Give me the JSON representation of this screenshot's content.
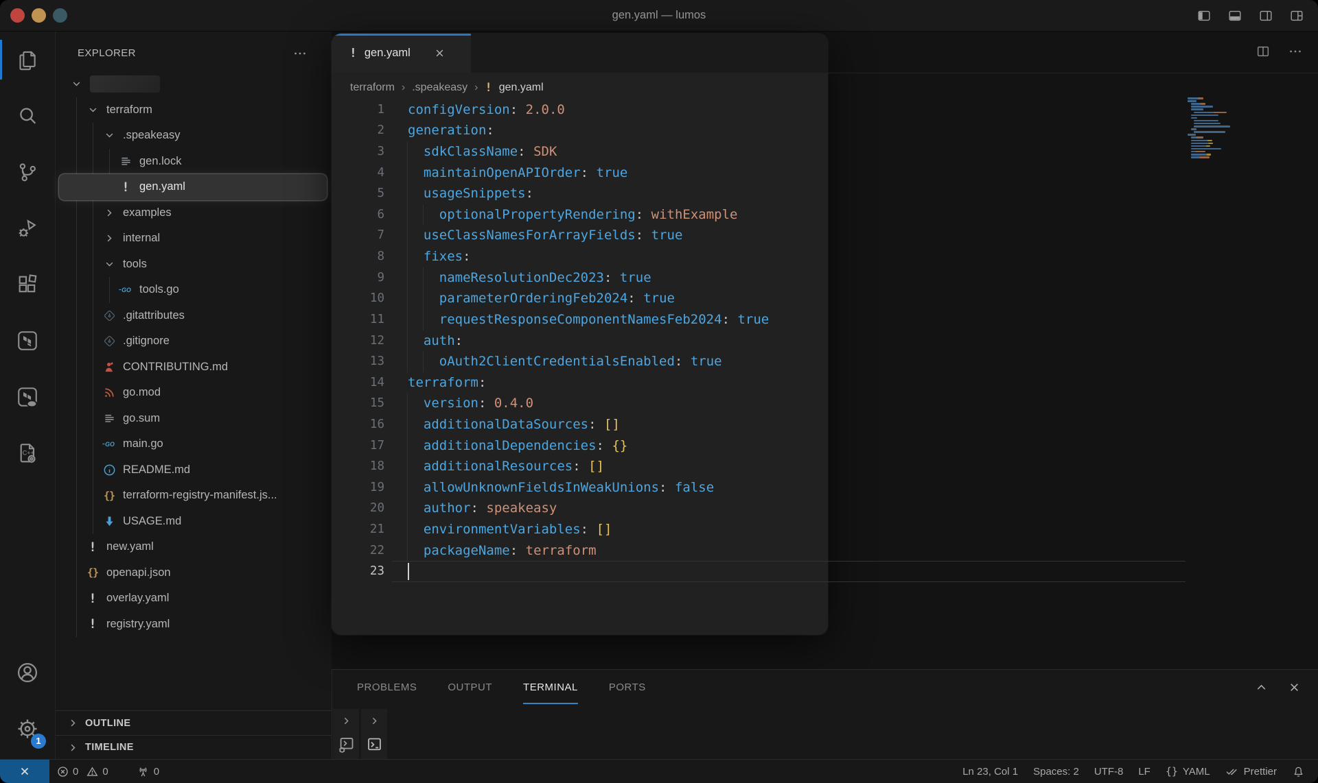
{
  "window": {
    "title": "gen.yaml — lumos",
    "traffic_lights": [
      {
        "name": "close",
        "color": "#c0453e"
      },
      {
        "name": "minimize",
        "color": "#bf9351"
      },
      {
        "name": "zoom",
        "color": "#3b5866"
      }
    ],
    "titlebar_actions": [
      "toggle-primary-sidebar",
      "toggle-panel",
      "toggle-secondary-sidebar",
      "customize-layout"
    ]
  },
  "activity_bar": {
    "top": [
      {
        "name": "explorer",
        "active": true
      },
      {
        "name": "search"
      },
      {
        "name": "source-control"
      },
      {
        "name": "run-and-debug"
      },
      {
        "name": "extensions"
      },
      {
        "name": "terraform"
      },
      {
        "name": "terraform-cloud"
      },
      {
        "name": "api-docs"
      }
    ],
    "bottom": [
      {
        "name": "accounts"
      },
      {
        "name": "manage",
        "badge": "1"
      }
    ]
  },
  "explorer": {
    "title": "EXPLORER",
    "tree": [
      {
        "type": "root",
        "label": "",
        "indent": 0,
        "chevron": "expanded",
        "redacted": true
      },
      {
        "label": "terraform",
        "indent": 1,
        "chevron": "expanded"
      },
      {
        "label": ".speakeasy",
        "indent": 2,
        "chevron": "expanded"
      },
      {
        "label": "gen.lock",
        "indent": 3,
        "icon": "list"
      },
      {
        "label": "gen.yaml",
        "indent": 3,
        "icon": "yaml-warn",
        "selected": true
      },
      {
        "label": "examples",
        "indent": 2,
        "chevron": "collapsed"
      },
      {
        "label": "internal",
        "indent": 2,
        "chevron": "collapsed"
      },
      {
        "label": "tools",
        "indent": 2,
        "chevron": "expanded"
      },
      {
        "label": "tools.go",
        "indent": 3,
        "icon": "go"
      },
      {
        "label": ".gitattributes",
        "indent": 2,
        "icon": "git"
      },
      {
        "label": ".gitignore",
        "indent": 2,
        "icon": "git"
      },
      {
        "label": "CONTRIBUTING.md",
        "indent": 2,
        "icon": "contrib"
      },
      {
        "label": "go.mod",
        "indent": 2,
        "icon": "gomod"
      },
      {
        "label": "go.sum",
        "indent": 2,
        "icon": "list"
      },
      {
        "label": "main.go",
        "indent": 2,
        "icon": "go"
      },
      {
        "label": "README.md",
        "indent": 2,
        "icon": "info"
      },
      {
        "label": "terraform-registry-manifest.js...",
        "indent": 2,
        "icon": "json"
      },
      {
        "label": "USAGE.md",
        "indent": 2,
        "icon": "arrow-down"
      },
      {
        "label": "new.yaml",
        "indent": 1,
        "icon": "yaml-warn"
      },
      {
        "label": "openapi.json",
        "indent": 1,
        "icon": "json"
      },
      {
        "label": "overlay.yaml",
        "indent": 1,
        "icon": "yaml-warn"
      },
      {
        "label": "registry.yaml",
        "indent": 1,
        "icon": "yaml-warn"
      }
    ],
    "sections": [
      "OUTLINE",
      "TIMELINE"
    ]
  },
  "editor": {
    "tab": {
      "label": "gen.yaml"
    },
    "breadcrumb": [
      "terraform",
      ".speakeasy",
      "gen.yaml"
    ],
    "cursor": {
      "line": 23,
      "col": 1
    },
    "code": [
      {
        "i": 0,
        "t": [
          [
            "configVersion",
            "k"
          ],
          [
            ":",
            "p"
          ],
          [
            " ",
            "w"
          ],
          [
            "2.0.0",
            "s"
          ]
        ]
      },
      {
        "i": 0,
        "t": [
          [
            "generation",
            "k"
          ],
          [
            ":",
            "p"
          ]
        ]
      },
      {
        "i": 1,
        "t": [
          [
            "sdkClassName",
            "k"
          ],
          [
            ":",
            "p"
          ],
          [
            " ",
            "w"
          ],
          [
            "SDK",
            "s"
          ]
        ]
      },
      {
        "i": 1,
        "t": [
          [
            "maintainOpenAPIOrder",
            "k"
          ],
          [
            ":",
            "p"
          ],
          [
            " ",
            "w"
          ],
          [
            "true",
            "b"
          ]
        ]
      },
      {
        "i": 1,
        "t": [
          [
            "usageSnippets",
            "k"
          ],
          [
            ":",
            "p"
          ]
        ]
      },
      {
        "i": 2,
        "t": [
          [
            "optionalPropertyRendering",
            "k"
          ],
          [
            ":",
            "p"
          ],
          [
            " ",
            "w"
          ],
          [
            "withExample",
            "s"
          ]
        ]
      },
      {
        "i": 1,
        "t": [
          [
            "useClassNamesForArrayFields",
            "k"
          ],
          [
            ":",
            "p"
          ],
          [
            " ",
            "w"
          ],
          [
            "true",
            "b"
          ]
        ]
      },
      {
        "i": 1,
        "t": [
          [
            "fixes",
            "k"
          ],
          [
            ":",
            "p"
          ]
        ]
      },
      {
        "i": 2,
        "t": [
          [
            "nameResolutionDec2023",
            "k"
          ],
          [
            ":",
            "p"
          ],
          [
            " ",
            "w"
          ],
          [
            "true",
            "b"
          ]
        ]
      },
      {
        "i": 2,
        "t": [
          [
            "parameterOrderingFeb2024",
            "k"
          ],
          [
            ":",
            "p"
          ],
          [
            " ",
            "w"
          ],
          [
            "true",
            "b"
          ]
        ]
      },
      {
        "i": 2,
        "t": [
          [
            "requestResponseComponentNamesFeb2024",
            "k"
          ],
          [
            ":",
            "p"
          ],
          [
            " ",
            "w"
          ],
          [
            "true",
            "b"
          ]
        ]
      },
      {
        "i": 1,
        "t": [
          [
            "auth",
            "k"
          ],
          [
            ":",
            "p"
          ]
        ]
      },
      {
        "i": 2,
        "t": [
          [
            "oAuth2ClientCredentialsEnabled",
            "k"
          ],
          [
            ":",
            "p"
          ],
          [
            " ",
            "w"
          ],
          [
            "true",
            "b"
          ]
        ]
      },
      {
        "i": 0,
        "t": [
          [
            "terraform",
            "k"
          ],
          [
            ":",
            "p"
          ]
        ]
      },
      {
        "i": 1,
        "t": [
          [
            "version",
            "k"
          ],
          [
            ":",
            "p"
          ],
          [
            " ",
            "w"
          ],
          [
            "0.4.0",
            "s"
          ]
        ]
      },
      {
        "i": 1,
        "t": [
          [
            "additionalDataSources",
            "k"
          ],
          [
            ":",
            "p"
          ],
          [
            " ",
            "w"
          ],
          [
            "[]",
            "g"
          ]
        ]
      },
      {
        "i": 1,
        "t": [
          [
            "additionalDependencies",
            "k"
          ],
          [
            ":",
            "p"
          ],
          [
            " ",
            "w"
          ],
          [
            "{}",
            "g"
          ]
        ]
      },
      {
        "i": 1,
        "t": [
          [
            "additionalResources",
            "k"
          ],
          [
            ":",
            "p"
          ],
          [
            " ",
            "w"
          ],
          [
            "[]",
            "g"
          ]
        ]
      },
      {
        "i": 1,
        "t": [
          [
            "allowUnknownFieldsInWeakUnions",
            "k"
          ],
          [
            ":",
            "p"
          ],
          [
            " ",
            "w"
          ],
          [
            "false",
            "b"
          ]
        ]
      },
      {
        "i": 1,
        "t": [
          [
            "author",
            "k"
          ],
          [
            ":",
            "p"
          ],
          [
            " ",
            "w"
          ],
          [
            "speakeasy",
            "s"
          ]
        ]
      },
      {
        "i": 1,
        "t": [
          [
            "environmentVariables",
            "k"
          ],
          [
            ":",
            "p"
          ],
          [
            " ",
            "w"
          ],
          [
            "[]",
            "g"
          ]
        ]
      },
      {
        "i": 1,
        "t": [
          [
            "packageName",
            "k"
          ],
          [
            ":",
            "p"
          ],
          [
            " ",
            "w"
          ],
          [
            "terraform",
            "s"
          ]
        ]
      },
      {
        "i": 0,
        "t": []
      }
    ]
  },
  "panel": {
    "tabs": [
      "PROBLEMS",
      "OUTPUT",
      "TERMINAL",
      "PORTS"
    ],
    "active_tab": "TERMINAL",
    "terminal_tiles": [
      "debug-terminal",
      "terminal"
    ]
  },
  "status_bar": {
    "errors": "0",
    "warnings": "0",
    "forwarded_ports": "0",
    "right": [
      {
        "name": "cursor-position",
        "label": "Ln 23, Col 1"
      },
      {
        "name": "indentation",
        "label": "Spaces: 2"
      },
      {
        "name": "encoding",
        "label": "UTF-8"
      },
      {
        "name": "eol",
        "label": "LF"
      },
      {
        "name": "language-mode",
        "label": "YAML",
        "icon": "braces"
      },
      {
        "name": "formatter",
        "label": "Prettier",
        "icon": "double-check"
      },
      {
        "name": "notifications",
        "label": "",
        "icon": "bell"
      }
    ]
  },
  "colors": {
    "accent": "#2e86c9",
    "key": "#4da6e0",
    "punct": "#c8c8c8",
    "str": "#ce9178",
    "bool": "#4da6e0",
    "brack": "#e8c45c",
    "remote_bg": "#13568c",
    "panel_bg": "#212121",
    "selection_glow": "#333333"
  }
}
